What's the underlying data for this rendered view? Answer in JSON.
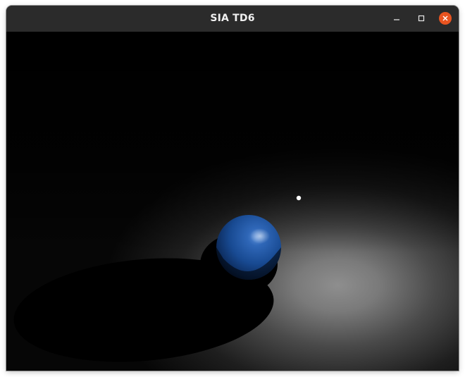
{
  "window": {
    "title": "SIA TD6",
    "buttons": {
      "minimize": "minimize-icon",
      "maximize": "maximize-icon",
      "close": "close-icon"
    },
    "close_color": "#e95420"
  },
  "scene": {
    "sphere_color": "#1f56a8",
    "background_color": "#000000",
    "floor_light_color": "#8c8c8c"
  }
}
